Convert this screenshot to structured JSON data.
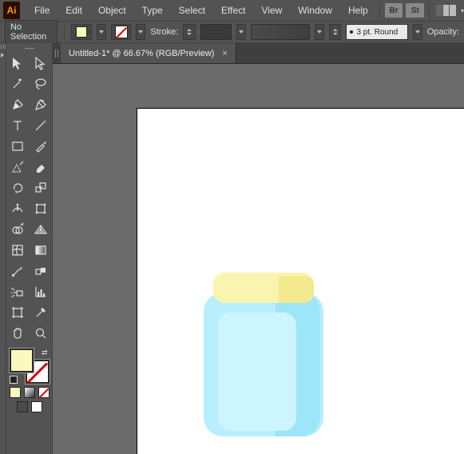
{
  "menu": {
    "file": "File",
    "edit": "Edit",
    "object": "Object",
    "type": "Type",
    "select": "Select",
    "effect": "Effect",
    "view": "View",
    "window": "Window",
    "help": "Help",
    "ext_br": "Br",
    "ext_st": "St"
  },
  "options": {
    "no_selection": "No Selection",
    "stroke_label": "Stroke:",
    "brush_text": "3 pt. Round",
    "opacity_label": "Opacity:"
  },
  "document": {
    "tab_title": "Untitled-1* @ 66.67% (RGB/Preview)",
    "close": "×"
  },
  "colors": {
    "fill": "#fdf8bd",
    "accent_ai": "#ff9a00",
    "jar_body": "#b7efff",
    "jar_body_shadow": "#9de5f8",
    "jar_panel": "#cdf5ff",
    "jar_lid": "#fbf3b0",
    "jar_lid_shadow": "#f3e98e"
  },
  "app": {
    "logo_text": "Ai"
  }
}
